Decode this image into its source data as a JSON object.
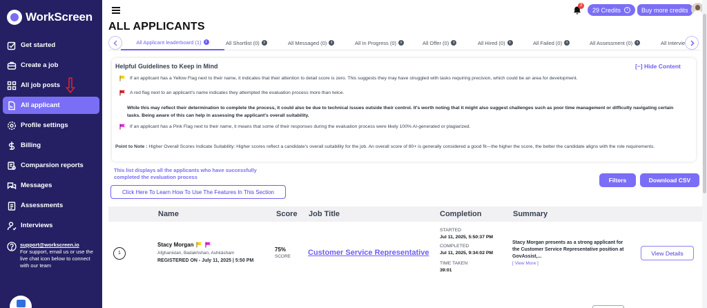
{
  "brand": {
    "name": "WorkScreen"
  },
  "sidebar": {
    "items": [
      {
        "label": "Get started",
        "icon": "checkbox-pencil-icon",
        "active": false
      },
      {
        "label": "Create a job",
        "icon": "briefcase-icon",
        "active": false
      },
      {
        "label": "All job posts",
        "icon": "grid-icon",
        "active": false
      },
      {
        "label": "All applicant",
        "icon": "document-icon",
        "active": true
      },
      {
        "label": "Profile settings",
        "icon": "gear-icon",
        "active": false
      },
      {
        "label": "Billing",
        "icon": "dollar-icon",
        "active": false
      },
      {
        "label": "Comparsion reports",
        "icon": "report-icon",
        "active": false
      },
      {
        "label": "Messages",
        "icon": "messages-icon",
        "active": false
      },
      {
        "label": "Assessments",
        "icon": "clipboard-icon",
        "active": false
      },
      {
        "label": "Interviews",
        "icon": "user-icon",
        "active": false
      }
    ],
    "support_email": "support@workscreen.io",
    "support_text": "For support, email us or use the live chat icon below to connect with our team"
  },
  "topbar": {
    "notification_count": "3",
    "credits_label": "29 Credits",
    "buy_label": "Buy more credits"
  },
  "page": {
    "title": "ALL APPLICANTS"
  },
  "tabs": [
    {
      "label": "All Applicant leaderboard (1)",
      "active": true
    },
    {
      "label": "All Shortlist (0)",
      "active": false
    },
    {
      "label": "All Messaged (0)",
      "active": false
    },
    {
      "label": "All In Progress (0)",
      "active": false
    },
    {
      "label": "All Offer (0)",
      "active": false
    },
    {
      "label": "All Hired (0)",
      "active": false
    },
    {
      "label": "All Failed (0)",
      "active": false
    },
    {
      "label": "All Assessment (0)",
      "active": false
    },
    {
      "label": "All Intervie",
      "active": false
    }
  ],
  "guidelines": {
    "title": "Helpful Guidelines to Keep in Mind",
    "hide_label": "[−] Hide Content",
    "yellow_flag": "If an applicant has a Yellow Flag next to their name, it indicates that their attention to detail score is zero. This suggests they may have struggled with tasks requiring precision, which could be an area for development.",
    "red_flag": "A red flag next to an applicant's name indicates they attempted the evaluation process more than twice.",
    "red_flag_detail": "While this may reflect their determination to complete the process, it could also be due to technical issues outside their control. It's worth noting that it might also suggest challenges such as poor time management or difficulty navigating certain tasks. Being aware of this can help in assessing the applicant's overall suitability.",
    "pink_flag": "If an applicant has a Pink Flag next to their name, it means that some of their responses during the evaluation process were likely 100% AI-generated or plagiarized.",
    "note_label": "Point to Note :",
    "note_text": " Higher Overall Scores Indicate Suitability: Higher scores reflect a candidate's overall suitability for the job. An overall score of 80+ is generally considered a good fit—the higher the score, the better the candidate aligns with the role requirements."
  },
  "list_note": "This list displays all the applicants who have successfully completed the evaluation process",
  "buttons": {
    "learn": "Click Here To Learn How To Use The Features In This Section",
    "filters": "Filters",
    "csv": "Download CSV",
    "view_details": "View Details"
  },
  "table": {
    "headers": {
      "name": "Name",
      "score": "Score",
      "job": "Job Title",
      "completion": "Completion",
      "summary": "Summary"
    },
    "rows": [
      {
        "rank": "1",
        "name": "Stacy Morgan",
        "location": "Afghanistan, Badakhshan, Ashkāsham",
        "registered": "REGISTERED ON - July 11, 2025 | 5:50 PM",
        "score": "75%",
        "score_label": "SCORE",
        "job_title": "Customer Service Representative",
        "started_label": "STARTED",
        "started": "Jul 11, 2025, 5:50:37 PM",
        "completed_label": "COMPLETED",
        "completed": "Jul 11, 2025, 9:34:02 PM",
        "time_label": "TIME TAKEN",
        "time_taken": "39:01",
        "summary": "Stacy Morgan presents as a strong applicant for the Customer Service Representative position at GovAssist,...",
        "view_more": "[ View More ]"
      }
    ]
  },
  "colors": {
    "sidebar": "#242063",
    "accent": "#7b6ef6",
    "yellow_flag": "#f5d000",
    "red_flag": "#e11d1d",
    "pink_flag": "#e026d9"
  }
}
